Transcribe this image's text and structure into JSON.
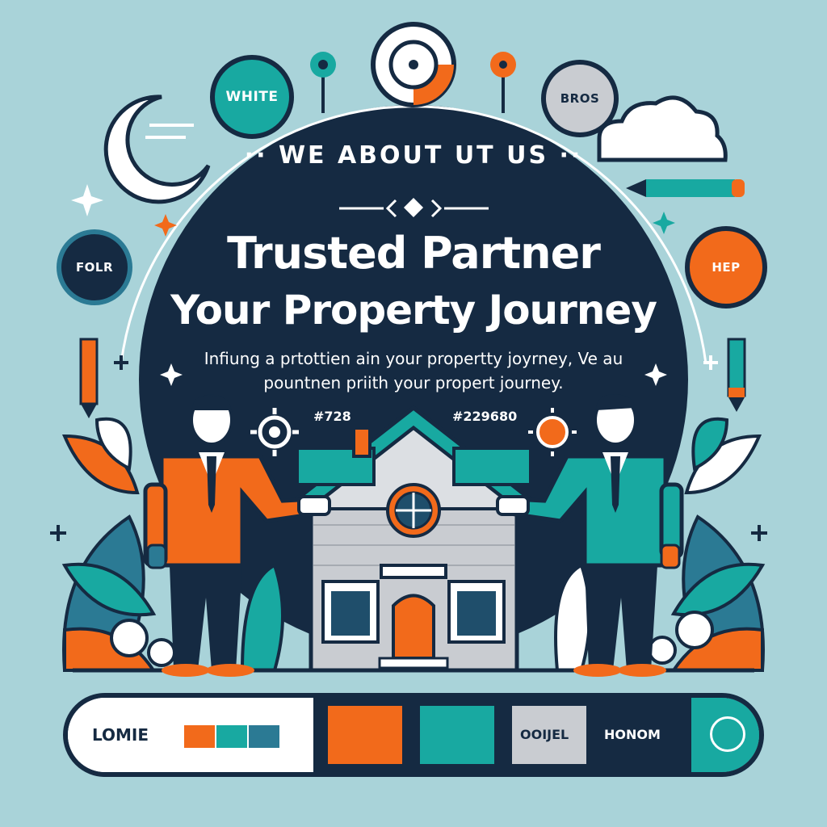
{
  "colors": {
    "background": "#a9d3d9",
    "navy": "#152a42",
    "teal": "#18a9a1",
    "orange": "#f26a1b",
    "white": "#ffffff",
    "gray": "#c9ccd1"
  },
  "top_badges": {
    "white_label": "WHITE",
    "bros_label": "BROS"
  },
  "side_badges": {
    "left_label": "FOLR",
    "right_label": "HEP"
  },
  "hero": {
    "eyebrow": "·· WE  ABOUT UT US ··",
    "title_line1": "Trusted Partner",
    "title_line2": "Your Property Journey",
    "subtitle_line1": "Infiung a prtottien ain your propertty joyrney, Ve au",
    "subtitle_line2": "pountnen priith your propert journey.",
    "code_left": "#728",
    "code_right": "#229680"
  },
  "bottom_bar": {
    "left_label": "LOMIE",
    "mid_label": "OOIJEL",
    "right_label": "HONOM"
  },
  "icons": [
    "moon-icon",
    "cloud-icon",
    "pencil-icon",
    "target-icon",
    "pin-icon",
    "sparkle-icon",
    "gear-icon",
    "sun-icon",
    "house-icon",
    "leaf-icon"
  ]
}
